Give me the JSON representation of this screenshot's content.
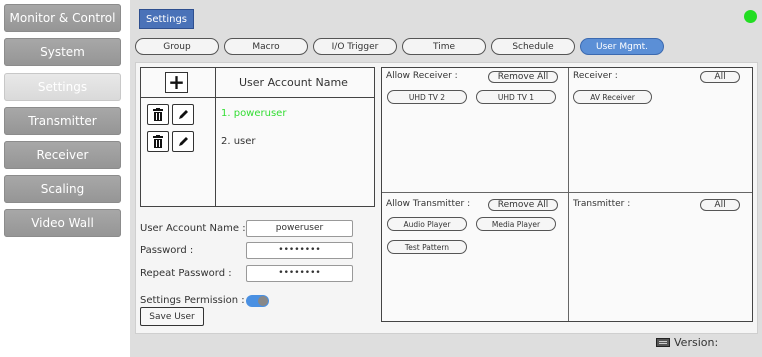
{
  "sidebar": {
    "items": [
      {
        "label": "Monitor & Control",
        "active": false
      },
      {
        "label": "System",
        "active": false
      },
      {
        "label": "Settings",
        "active": true
      },
      {
        "label": "Transmitter",
        "active": false
      },
      {
        "label": "Receiver",
        "active": false
      },
      {
        "label": "Scaling",
        "active": false
      },
      {
        "label": "Video Wall",
        "active": false
      }
    ]
  },
  "header": {
    "section_tag": "Settings",
    "status_color": "#22dd22"
  },
  "tabs": [
    "Group",
    "Macro",
    "I/O Trigger",
    "Time",
    "Schedule",
    "User Mgmt."
  ],
  "active_tab": "User Mgmt.",
  "users_panel": {
    "add_icon": "plus-icon",
    "column_header": "User Account Name",
    "users": [
      "1. poweruser",
      "2. user"
    ],
    "selected_user": "1. poweruser",
    "row_icons": [
      "trash-icon",
      "pencil-icon"
    ]
  },
  "form": {
    "account_name_label": "User Account Name :",
    "account_name_value": "poweruser",
    "password_label": "Password :",
    "password_value": "••••••••",
    "repeat_password_label": "Repeat Password :",
    "repeat_password_value": "••••••••",
    "permission_label": "Settings Permission :",
    "permission_enabled": true,
    "save_label": "Save User"
  },
  "routing": {
    "allow_receiver_label": "Allow Receiver :",
    "remove_all_label": "Remove All",
    "allowed_receivers": [
      "UHD TV 2",
      "UHD TV 1"
    ],
    "receiver_label": "Receiver :",
    "all_label": "All",
    "receivers": [
      "AV Receiver"
    ],
    "allow_transmitter_label": "Allow Transmitter :",
    "allowed_transmitters": [
      "Audio Player",
      "Media Player",
      "Test Pattern"
    ],
    "transmitter_label": "Transmitter :",
    "transmitters": []
  },
  "footer": {
    "version_label": "Version:",
    "version_icon": "keyboard-icon"
  }
}
